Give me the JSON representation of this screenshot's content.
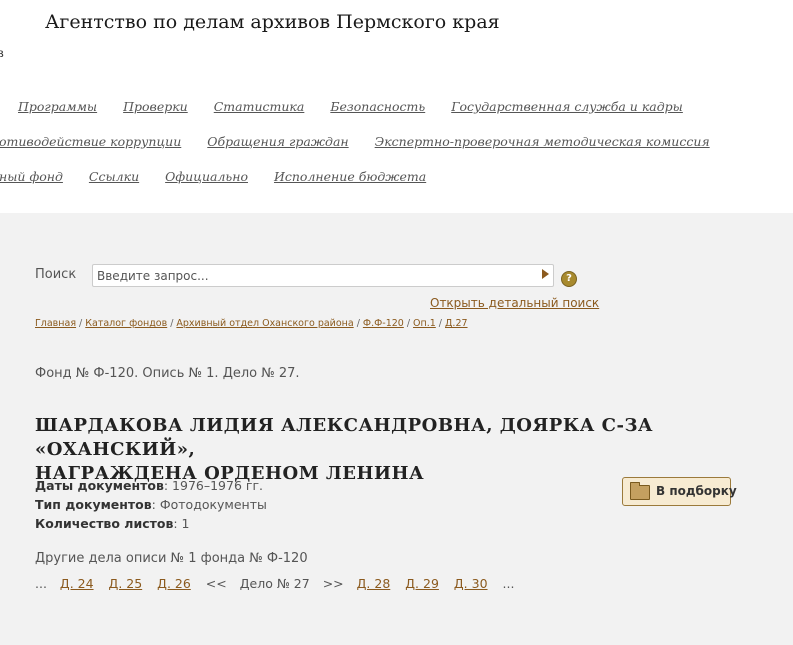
{
  "site": {
    "title": "Агентство по делам архивов Пермского края",
    "cut_fragment": "в"
  },
  "nav": {
    "row1": [
      "Программы",
      "Проверки",
      "Статистика",
      "Безопасность",
      "Государственная служба и кадры"
    ],
    "row2": [
      "отиводействие коррупции",
      "Обращения граждан",
      "Экспертно-проверочная методическая комиссия"
    ],
    "row3": [
      "ный фонд",
      "Ссылки",
      "Официально",
      "Исполнение бюджета"
    ]
  },
  "search": {
    "label": "Поиск",
    "placeholder": "Введите запрос...",
    "help_icon": "?",
    "advanced_link": "Открыть детальный поиск"
  },
  "breadcrumbs": [
    "Главная",
    "Каталог фондов",
    "Архивный отдел Оханского района",
    "Ф.Ф-120",
    "Оп.1",
    "Д.27"
  ],
  "record": {
    "fund_line": "Фонд № Ф-120. Опись № 1. Дело № 27.",
    "title_line1": "ШАРДАКОВА ЛИДИЯ АЛЕКСАНДРОВНА, ДОЯРКА С-ЗА «ОХАНСКИЙ»,",
    "title_line2": "НАГРАЖДЕНА ОРДЕНОМ ЛЕНИНА",
    "dates_label": "Даты документов",
    "dates_value": "1976–1976 гг.",
    "type_label": "Тип документов",
    "type_value": "Фотодокументы",
    "sheets_label": "Количество листов",
    "sheets_value": "1",
    "add_button": "В подборку",
    "add_icon": "folder-icon"
  },
  "pager": {
    "heading": "Другие дела описи № 1 фонда № Ф-120",
    "ellipsis": "...",
    "prev_links": [
      "Д. 24",
      "Д. 25",
      "Д. 26"
    ],
    "prev_arrow": "<<",
    "current": "Дело № 27",
    "next_arrow": ">>",
    "next_links": [
      "Д. 28",
      "Д. 29",
      "Д. 30"
    ]
  },
  "colors": {
    "link": "#8b5a1e",
    "content_bg": "#f2f2f2",
    "button_bg": "#f7ebd2"
  }
}
